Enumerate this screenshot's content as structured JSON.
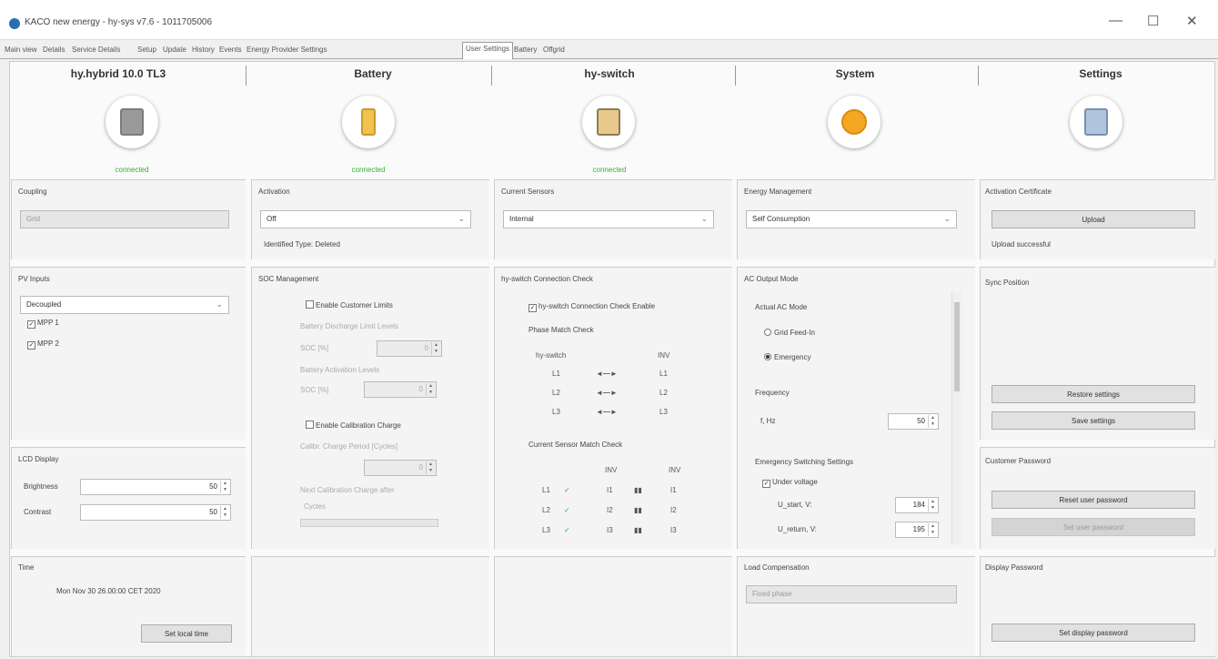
{
  "window": {
    "title": "KACO new energy - hy-sys v7.6 - 1011705006",
    "min": "—",
    "max": "☐",
    "close": "✕"
  },
  "tabs": [
    "Main view",
    "Details",
    "Service Details",
    "Setup",
    "Update",
    "History",
    "Events",
    "Energy Provider Settings",
    "User Settings",
    "Battery",
    "Offgrid"
  ],
  "devices": [
    {
      "name": "hy.hybrid 10.0 TL3",
      "status": "connected",
      "color": "#9a9a9a"
    },
    {
      "name": "Battery",
      "status": "connected",
      "color": "#f2c14e"
    },
    {
      "name": "hy-switch",
      "status": "connected",
      "color": "#e8c88a"
    },
    {
      "name": "System",
      "status": "",
      "color": "#f5a623"
    },
    {
      "name": "Settings",
      "status": "",
      "color": "#b0c4de"
    }
  ],
  "coupling": {
    "title": "Coupling",
    "value": "Grid"
  },
  "pv_inputs": {
    "title": "PV Inputs",
    "value": "Decoupled",
    "mpp1": "MPP 1",
    "mpp2": "MPP 2"
  },
  "lcd": {
    "title": "LCD Display",
    "brightness_label": "Brightness",
    "brightness": "50",
    "contrast_label": "Contrast",
    "contrast": "50"
  },
  "time": {
    "title": "Time",
    "value": "Mon Nov 30 26.00:00 CET 2020",
    "button": "Set local time"
  },
  "activation": {
    "title": "Activation",
    "value": "Off",
    "identified": "Identified Type: Deleted"
  },
  "soc": {
    "title": "SOC Management",
    "enable_limits": "Enable Customer Limits",
    "discharge_label": "Battery Discharge Limit Levels",
    "soc_label1": "SOC [%]",
    "soc_value1": "0",
    "activation_label": "Battery Activation Levels",
    "soc_label2": "SOC [%]",
    "soc_value2": "0",
    "enable_calib": "Enable Calibration Charge",
    "cycles_label": "Calibr. Charge Period [Cycles]",
    "cycles_value": "0",
    "next_label": "Next Calibration Charge after",
    "next_value": "Cycles"
  },
  "current_sensors": {
    "title": "Current Sensors",
    "value": "Internal"
  },
  "hyswitch_check": {
    "title": "hy-switch Connection Check",
    "enable": "hy-switch Connection Check Enable",
    "phase_title": "Phase Match Check",
    "col_left": "hy-switch",
    "col_right": "INV",
    "phases": [
      {
        "l": "L1",
        "r": "L1"
      },
      {
        "l": "L2",
        "r": "L2"
      },
      {
        "l": "L3",
        "r": "L3"
      }
    ],
    "arrow": "◄—►",
    "sensor_title": "Current Sensor Match Check",
    "sensor_h1": "INV",
    "sensor_h2": "INV",
    "sensor_rows": [
      {
        "a": "L1",
        "b": "✓",
        "c": "I1",
        "d": "▮▮",
        "e": "I1"
      },
      {
        "a": "L2",
        "b": "✓",
        "c": "I2",
        "d": "▮▮",
        "e": "I2"
      },
      {
        "a": "L3",
        "b": "✓",
        "c": "I3",
        "d": "▮▮",
        "e": "I3"
      }
    ]
  },
  "energy": {
    "title": "Energy Management",
    "value": "Self Consumption"
  },
  "ac_output": {
    "title": "AC Output Mode",
    "active_label": "Actual AC Mode",
    "opt1": "Grid Feed-In",
    "opt2": "Emergency",
    "freq_title": "Frequency",
    "freq_label": "f, Hz",
    "freq_value": "50",
    "emergency_title": "Emergency Switching Settings",
    "under_voltage": "Under voltage",
    "u1_label": "U_start, V:",
    "u1_value": "184",
    "u2_label": "U_return, V:",
    "u2_value": "195"
  },
  "load": {
    "title": "Load Compensation",
    "value": "Fixed phase"
  },
  "activation_cert": {
    "title": "Activation Certificate",
    "button": "Upload",
    "msg": "Upload successful"
  },
  "sync": {
    "title": "Sync Position",
    "restore": "Restore settings",
    "save": "Save settings"
  },
  "customer_pw": {
    "title": "Customer Password",
    "reset": "Reset user password",
    "set": "Set user password"
  },
  "display_pw": {
    "title": "Display Password",
    "button": "Set display password"
  }
}
